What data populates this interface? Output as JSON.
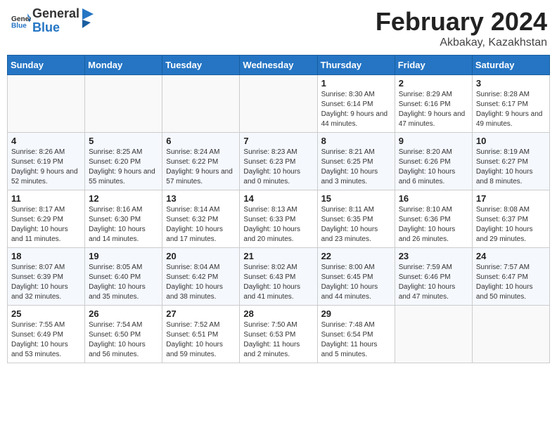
{
  "header": {
    "logo_general": "General",
    "logo_blue": "Blue",
    "month_year": "February 2024",
    "location": "Akbakay, Kazakhstan"
  },
  "weekdays": [
    "Sunday",
    "Monday",
    "Tuesday",
    "Wednesday",
    "Thursday",
    "Friday",
    "Saturday"
  ],
  "weeks": [
    [
      {
        "day": "",
        "info": ""
      },
      {
        "day": "",
        "info": ""
      },
      {
        "day": "",
        "info": ""
      },
      {
        "day": "",
        "info": ""
      },
      {
        "day": "1",
        "info": "Sunrise: 8:30 AM\nSunset: 6:14 PM\nDaylight: 9 hours\nand 44 minutes."
      },
      {
        "day": "2",
        "info": "Sunrise: 8:29 AM\nSunset: 6:16 PM\nDaylight: 9 hours\nand 47 minutes."
      },
      {
        "day": "3",
        "info": "Sunrise: 8:28 AM\nSunset: 6:17 PM\nDaylight: 9 hours\nand 49 minutes."
      }
    ],
    [
      {
        "day": "4",
        "info": "Sunrise: 8:26 AM\nSunset: 6:19 PM\nDaylight: 9 hours\nand 52 minutes."
      },
      {
        "day": "5",
        "info": "Sunrise: 8:25 AM\nSunset: 6:20 PM\nDaylight: 9 hours\nand 55 minutes."
      },
      {
        "day": "6",
        "info": "Sunrise: 8:24 AM\nSunset: 6:22 PM\nDaylight: 9 hours\nand 57 minutes."
      },
      {
        "day": "7",
        "info": "Sunrise: 8:23 AM\nSunset: 6:23 PM\nDaylight: 10 hours\nand 0 minutes."
      },
      {
        "day": "8",
        "info": "Sunrise: 8:21 AM\nSunset: 6:25 PM\nDaylight: 10 hours\nand 3 minutes."
      },
      {
        "day": "9",
        "info": "Sunrise: 8:20 AM\nSunset: 6:26 PM\nDaylight: 10 hours\nand 6 minutes."
      },
      {
        "day": "10",
        "info": "Sunrise: 8:19 AM\nSunset: 6:27 PM\nDaylight: 10 hours\nand 8 minutes."
      }
    ],
    [
      {
        "day": "11",
        "info": "Sunrise: 8:17 AM\nSunset: 6:29 PM\nDaylight: 10 hours\nand 11 minutes."
      },
      {
        "day": "12",
        "info": "Sunrise: 8:16 AM\nSunset: 6:30 PM\nDaylight: 10 hours\nand 14 minutes."
      },
      {
        "day": "13",
        "info": "Sunrise: 8:14 AM\nSunset: 6:32 PM\nDaylight: 10 hours\nand 17 minutes."
      },
      {
        "day": "14",
        "info": "Sunrise: 8:13 AM\nSunset: 6:33 PM\nDaylight: 10 hours\nand 20 minutes."
      },
      {
        "day": "15",
        "info": "Sunrise: 8:11 AM\nSunset: 6:35 PM\nDaylight: 10 hours\nand 23 minutes."
      },
      {
        "day": "16",
        "info": "Sunrise: 8:10 AM\nSunset: 6:36 PM\nDaylight: 10 hours\nand 26 minutes."
      },
      {
        "day": "17",
        "info": "Sunrise: 8:08 AM\nSunset: 6:37 PM\nDaylight: 10 hours\nand 29 minutes."
      }
    ],
    [
      {
        "day": "18",
        "info": "Sunrise: 8:07 AM\nSunset: 6:39 PM\nDaylight: 10 hours\nand 32 minutes."
      },
      {
        "day": "19",
        "info": "Sunrise: 8:05 AM\nSunset: 6:40 PM\nDaylight: 10 hours\nand 35 minutes."
      },
      {
        "day": "20",
        "info": "Sunrise: 8:04 AM\nSunset: 6:42 PM\nDaylight: 10 hours\nand 38 minutes."
      },
      {
        "day": "21",
        "info": "Sunrise: 8:02 AM\nSunset: 6:43 PM\nDaylight: 10 hours\nand 41 minutes."
      },
      {
        "day": "22",
        "info": "Sunrise: 8:00 AM\nSunset: 6:45 PM\nDaylight: 10 hours\nand 44 minutes."
      },
      {
        "day": "23",
        "info": "Sunrise: 7:59 AM\nSunset: 6:46 PM\nDaylight: 10 hours\nand 47 minutes."
      },
      {
        "day": "24",
        "info": "Sunrise: 7:57 AM\nSunset: 6:47 PM\nDaylight: 10 hours\nand 50 minutes."
      }
    ],
    [
      {
        "day": "25",
        "info": "Sunrise: 7:55 AM\nSunset: 6:49 PM\nDaylight: 10 hours\nand 53 minutes."
      },
      {
        "day": "26",
        "info": "Sunrise: 7:54 AM\nSunset: 6:50 PM\nDaylight: 10 hours\nand 56 minutes."
      },
      {
        "day": "27",
        "info": "Sunrise: 7:52 AM\nSunset: 6:51 PM\nDaylight: 10 hours\nand 59 minutes."
      },
      {
        "day": "28",
        "info": "Sunrise: 7:50 AM\nSunset: 6:53 PM\nDaylight: 11 hours\nand 2 minutes."
      },
      {
        "day": "29",
        "info": "Sunrise: 7:48 AM\nSunset: 6:54 PM\nDaylight: 11 hours\nand 5 minutes."
      },
      {
        "day": "",
        "info": ""
      },
      {
        "day": "",
        "info": ""
      }
    ]
  ]
}
